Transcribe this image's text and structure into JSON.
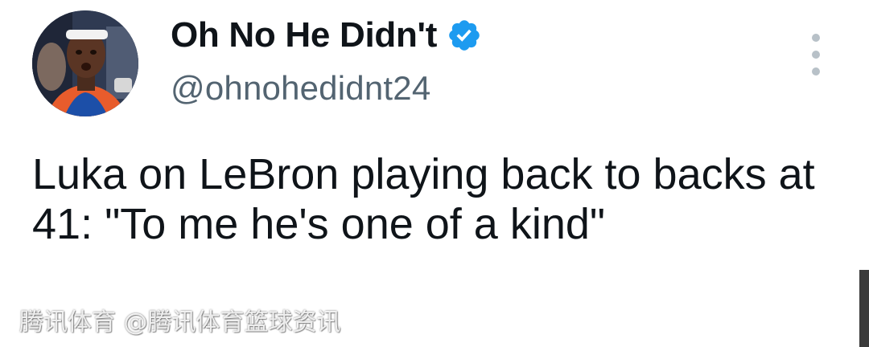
{
  "user": {
    "display_name": "Oh No He Didn't",
    "handle": "@ohnohedidnt24",
    "verified": true
  },
  "tweet": {
    "text": "Luka on LeBron playing back to backs at 41: \"To me he's one of a kind\""
  },
  "watermark": {
    "text": "腾讯体育 @腾讯体育篮球资讯"
  },
  "icons": {
    "verified": "verified-badge-icon",
    "more": "more-vertical-icon"
  },
  "colors": {
    "verified_blue": "#1d9bf0",
    "handle_gray": "#536471",
    "text": "#0f1419"
  }
}
